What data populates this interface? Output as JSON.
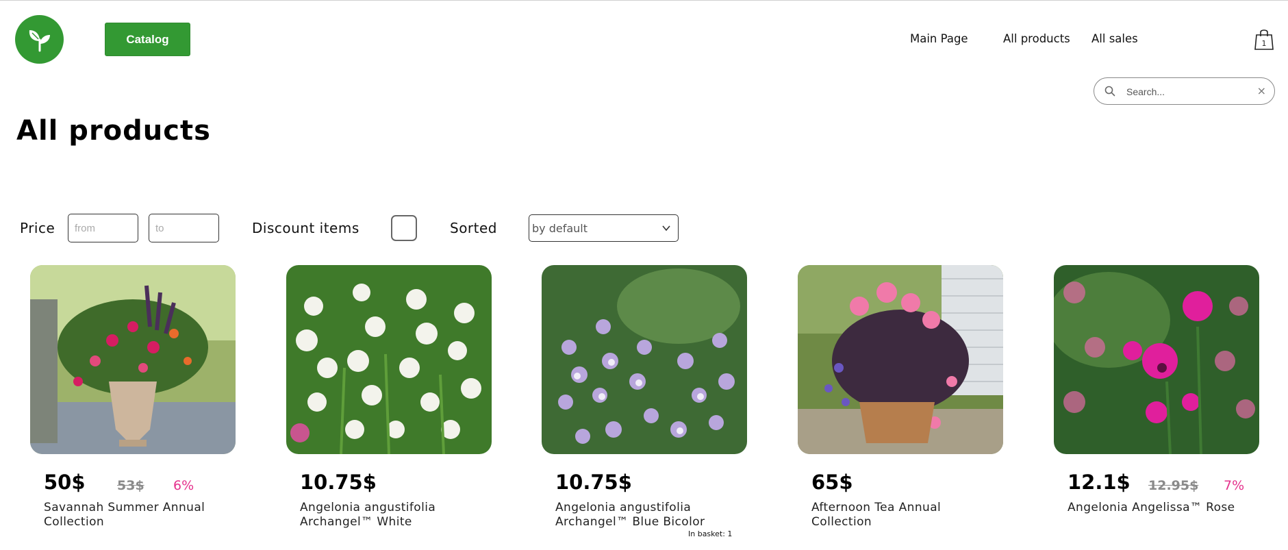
{
  "header": {
    "logo_icon": "sprout-leaf-icon",
    "catalog_label": "Catalog",
    "nav": [
      "Main Page",
      "All products",
      "All sales"
    ],
    "basket_icon": "shopping-bag-icon",
    "basket_count": "1"
  },
  "search": {
    "placeholder": "Search...",
    "value": "",
    "clear_label": "×"
  },
  "page": {
    "title": "All products"
  },
  "filters": {
    "price_label": "Price",
    "from_placeholder": "from",
    "to_placeholder": "to",
    "discount_label": "Discount items",
    "discount_checked": false,
    "sorted_label": "Sorted",
    "sorted_value": "by default"
  },
  "products": [
    {
      "price": "50$",
      "old_price": "53$",
      "discount": "6%",
      "name": "Savannah Summer Annual Collection"
    },
    {
      "price": "10.75$",
      "old_price": "",
      "discount": "",
      "name": "Angelonia angustifolia Archangel™ White"
    },
    {
      "price": "10.75$",
      "old_price": "",
      "discount": "",
      "name": "Angelonia angustifolia Archangel™ Blue Bicolor",
      "in_basket": "In basket: 1"
    },
    {
      "price": "65$",
      "old_price": "",
      "discount": "",
      "name": "Afternoon Tea Annual Collection"
    },
    {
      "price": "12.1$",
      "old_price": "12.95$",
      "discount": "7%",
      "name": "Angelonia Angelissa™ Rose"
    }
  ],
  "colors": {
    "brand_green": "#339933",
    "discount_pink": "#e5318c",
    "old_price_gray": "#8a8a8a"
  }
}
